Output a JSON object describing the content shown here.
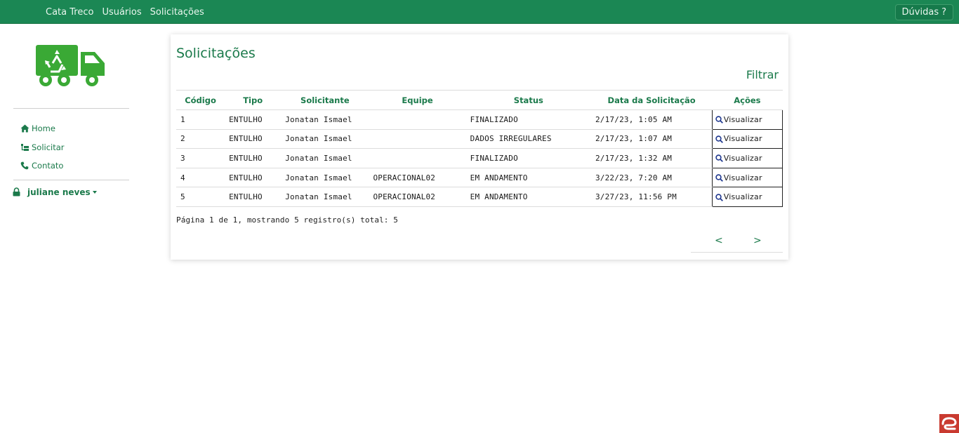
{
  "topbar": {
    "nav": [
      "Cata Treco",
      "Usuários",
      "Solicitações"
    ],
    "help_label": "Dúvidas",
    "help_icon": "question-icon"
  },
  "sidebar": {
    "logo_icon": "recycling-truck-icon",
    "links": [
      {
        "label": "Home",
        "icon": "home-icon"
      },
      {
        "label": "Solicitar",
        "icon": "request-icon"
      },
      {
        "label": "Contato",
        "icon": "phone-icon"
      }
    ],
    "user": {
      "name": "juliane neves",
      "icon": "lock-icon"
    }
  },
  "main": {
    "title": "Solicitações",
    "filter_label": "Filtrar",
    "table": {
      "columns": [
        "Código",
        "Tipo",
        "Solicitante",
        "Equipe",
        "Status",
        "Data da Solicitação",
        "Ações"
      ],
      "rows": [
        {
          "codigo": "1",
          "tipo": "ENTULHO",
          "solicitante": "Jonatan Ismael",
          "equipe": "",
          "status": "FINALIZADO",
          "data": "2/17/23, 1:05 AM",
          "acao": "Visualizar"
        },
        {
          "codigo": "2",
          "tipo": "ENTULHO",
          "solicitante": "Jonatan Ismael",
          "equipe": "",
          "status": "DADOS IRREGULARES",
          "data": "2/17/23, 1:07 AM",
          "acao": "Visualizar"
        },
        {
          "codigo": "3",
          "tipo": "ENTULHO",
          "solicitante": "Jonatan Ismael",
          "equipe": "",
          "status": "FINALIZADO",
          "data": "2/17/23, 1:32 AM",
          "acao": "Visualizar"
        },
        {
          "codigo": "4",
          "tipo": "ENTULHO",
          "solicitante": "Jonatan Ismael",
          "equipe": "OPERACIONAL02",
          "status": "EM ANDAMENTO",
          "data": "3/22/23, 7:20 AM",
          "acao": "Visualizar"
        },
        {
          "codigo": "5",
          "tipo": "ENTULHO",
          "solicitante": "Jonatan Ismael",
          "equipe": "OPERACIONAL02",
          "status": "EM ANDAMENTO",
          "data": "3/27/23, 11:56 PM",
          "acao": "Visualizar"
        }
      ]
    },
    "pagination": {
      "info": "Página 1 de 1, mostrando 5 registro(s) total: 5",
      "prev": "<",
      "next": ">"
    }
  },
  "colors": {
    "brand": "#1b8754",
    "text_green": "#1b7a4b",
    "logo_green": "#3aa935",
    "widget_red": "#c93a30"
  }
}
